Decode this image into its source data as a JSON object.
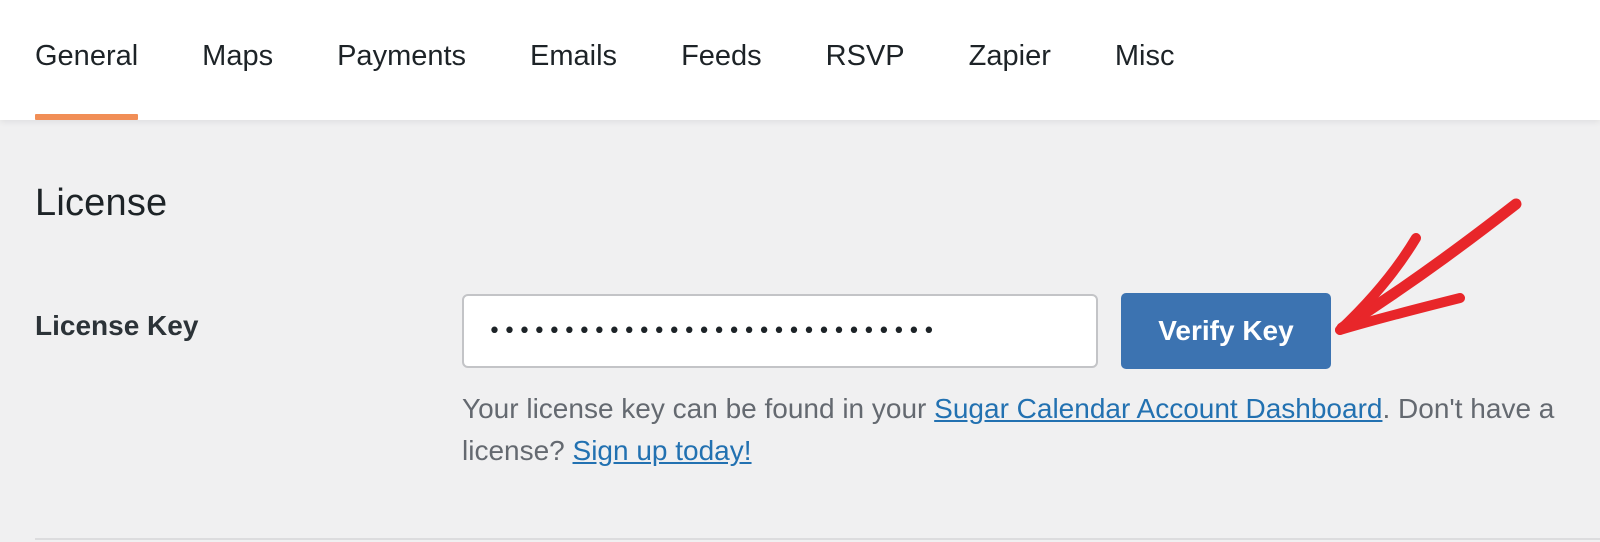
{
  "tabs": [
    {
      "label": "General",
      "active": true
    },
    {
      "label": "Maps",
      "active": false
    },
    {
      "label": "Payments",
      "active": false
    },
    {
      "label": "Emails",
      "active": false
    },
    {
      "label": "Feeds",
      "active": false
    },
    {
      "label": "RSVP",
      "active": false
    },
    {
      "label": "Zapier",
      "active": false
    },
    {
      "label": "Misc",
      "active": false
    }
  ],
  "section": {
    "title": "License"
  },
  "license": {
    "label": "License Key",
    "value": "••••••••••••••••••••••••••••••",
    "verify_label": "Verify Key",
    "help_prefix": "Your license key can be found in your ",
    "help_link1": "Sugar Calendar Account Dashboard",
    "help_mid": ". Don't have a license? ",
    "help_link2": "Sign up today!"
  },
  "colors": {
    "active_tab_underline": "#f18e56",
    "button_bg": "#3c73b1",
    "link": "#2271b1",
    "annotation": "#e8262a"
  },
  "icons": {
    "annotation": "hand-drawn-arrow-icon"
  }
}
